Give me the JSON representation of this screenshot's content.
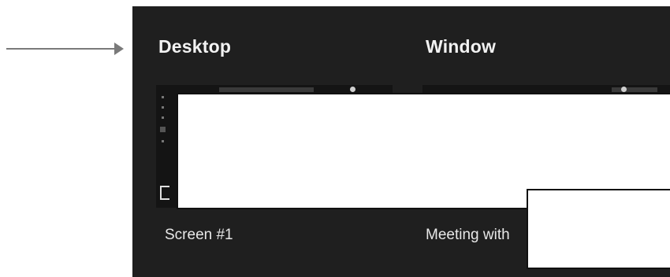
{
  "colors": {
    "panel_background": "#1f1f1f",
    "title_text": "#f2f2f2",
    "caption_text": "#e8e8e8",
    "annotation_arrow": "#7a7a7a",
    "redaction": "#ffffff"
  },
  "annotation": {
    "icon": "arrow-right-icon"
  },
  "share_panel": {
    "sections": [
      {
        "title": "Desktop",
        "option_caption": "Screen #1"
      },
      {
        "title": "Window",
        "option_caption": "Meeting with"
      }
    ]
  }
}
